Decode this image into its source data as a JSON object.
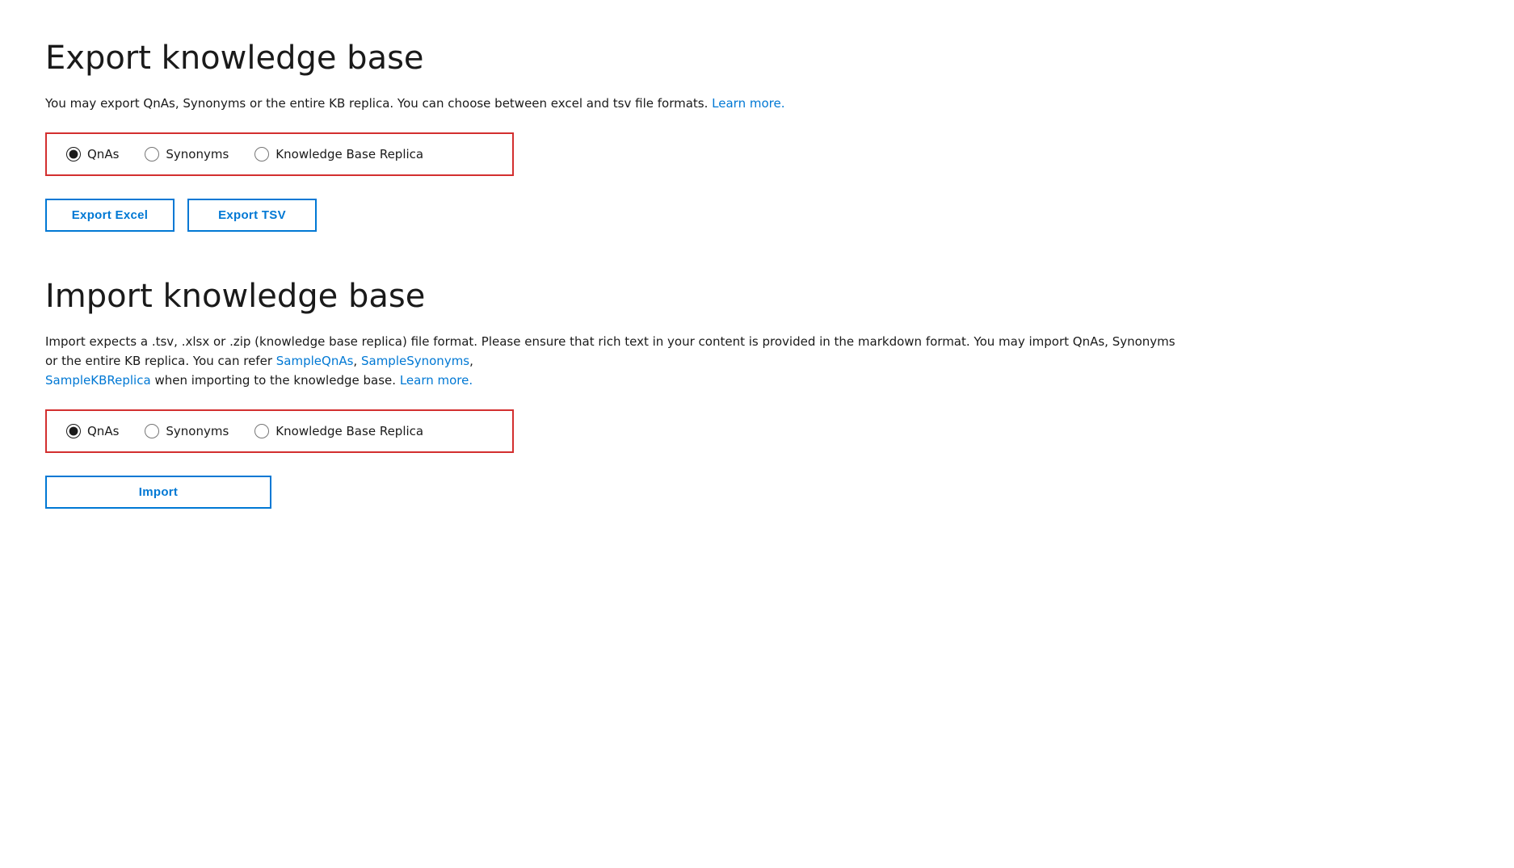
{
  "export_section": {
    "title": "Export knowledge base",
    "description": "You may export QnAs, Synonyms or the entire KB replica. You can choose between excel and tsv file formats.",
    "learn_more_link": "Learn more.",
    "radio_group": {
      "options": [
        {
          "id": "export-qnas",
          "label": "QnAs",
          "checked": true
        },
        {
          "id": "export-synonyms",
          "label": "Synonyms",
          "checked": false
        },
        {
          "id": "export-kb-replica",
          "label": "Knowledge Base Replica",
          "checked": false
        }
      ]
    },
    "buttons": [
      {
        "id": "export-excel",
        "label": "Export Excel"
      },
      {
        "id": "export-tsv",
        "label": "Export TSV"
      }
    ]
  },
  "import_section": {
    "title": "Import knowledge base",
    "description_parts": {
      "before_links": "Import expects a .tsv, .xlsx or .zip (knowledge base replica) file format. Please ensure that rich text in your content is provided in the markdown format. You may import QnAs, Synonyms or the entire KB replica. You can refer",
      "link1": "SampleQnAs",
      "comma1": ",",
      "link2": "SampleSynonyms",
      "comma2": ",",
      "link3": "SampleKBReplica",
      "after_links": "when importing to the knowledge base.",
      "learn_more_link": "Learn more."
    },
    "radio_group": {
      "options": [
        {
          "id": "import-qnas",
          "label": "QnAs",
          "checked": true
        },
        {
          "id": "import-synonyms",
          "label": "Synonyms",
          "checked": false
        },
        {
          "id": "import-kb-replica",
          "label": "Knowledge Base Replica",
          "checked": false
        }
      ]
    },
    "button": {
      "id": "import-btn",
      "label": "Import"
    }
  },
  "colors": {
    "border_highlight": "#d32f2f",
    "link_color": "#0078d4",
    "button_border": "#0078d4"
  }
}
